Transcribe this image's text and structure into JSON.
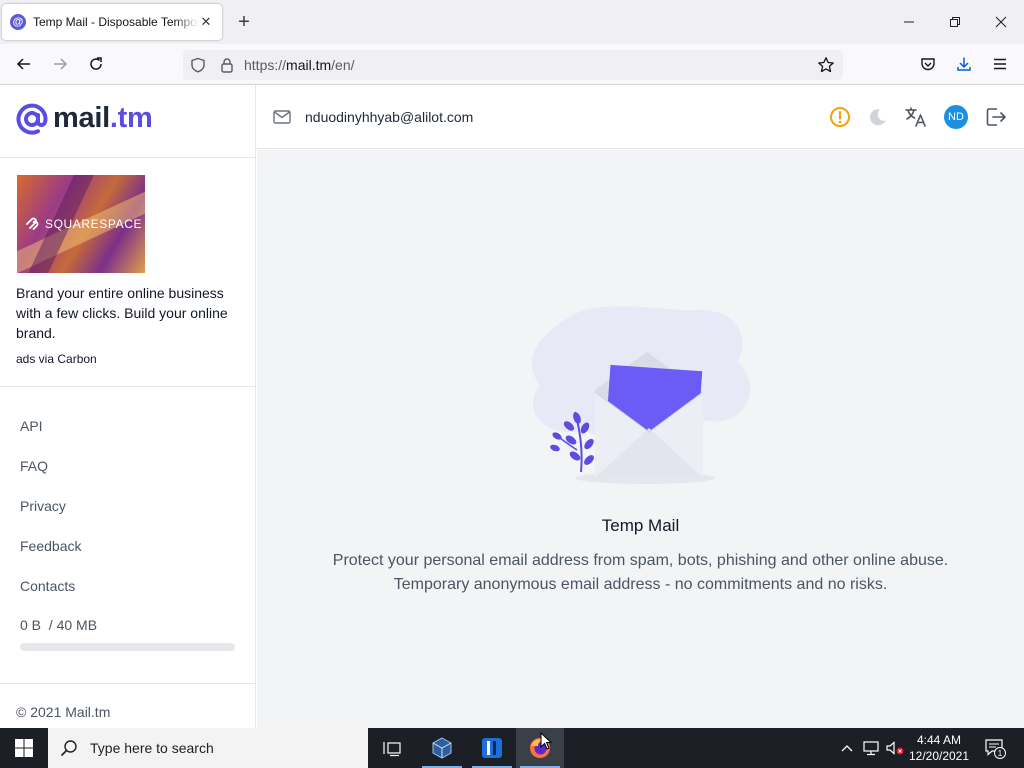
{
  "browser": {
    "tab_title": "Temp Mail - Disposable Temporary Email",
    "url_prefix": "https://",
    "url_host": "mail.tm",
    "url_path": "/en/"
  },
  "logo": {
    "name": "mail",
    "tld": ".tm"
  },
  "ad": {
    "brand": "SQUARESPACE",
    "text": "Brand your entire online business with a few clicks. Build your online brand.",
    "via": "ads via Carbon"
  },
  "sidebar": {
    "items": [
      {
        "label": "API"
      },
      {
        "label": "FAQ"
      },
      {
        "label": "Privacy"
      },
      {
        "label": "Feedback"
      },
      {
        "label": "Contacts"
      }
    ],
    "storage_text": "0 B  / 40 MB",
    "storage_fraction": 0,
    "copyright": "© 2021 Mail.tm"
  },
  "header": {
    "email": "nduodinyhhyab@alilot.com",
    "avatar_initials": "ND"
  },
  "main": {
    "title": "Temp Mail",
    "description_line1": "Protect your personal email address from spam, bots, phishing and other online abuse.",
    "description_line2": "Temporary anonymous email address - no commitments and no risks."
  },
  "taskbar": {
    "search_placeholder": "Type here to search",
    "time": "4:44 AM",
    "date": "12/20/2021",
    "notification_count": "1"
  },
  "colors": {
    "accent": "#5b4de0",
    "warning": "#f0a30a",
    "avatar": "#1d8fe0"
  }
}
